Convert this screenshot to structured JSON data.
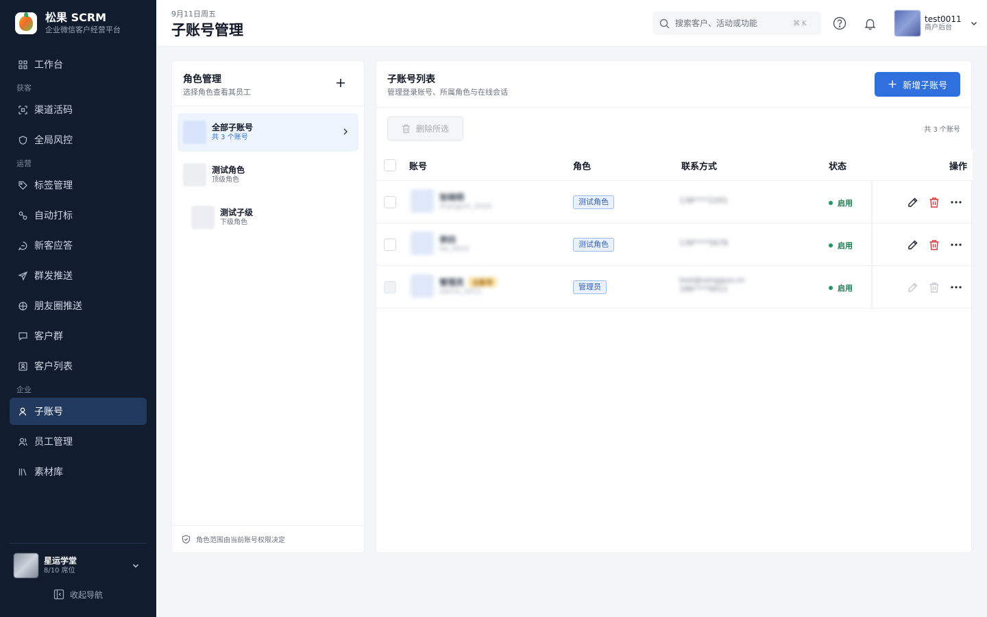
{
  "brand": {
    "title": "松果 SCRM",
    "subtitle": "企业微信客户经营平台"
  },
  "nav": {
    "workspace": "工作台",
    "group_acquire": "获客",
    "channel_code": "渠道活码",
    "risk_control": "全局风控",
    "group_ops": "运营",
    "tag_mgmt": "标签管理",
    "auto_tag": "自动打标",
    "new_customer": "新客应答",
    "mass_send": "群发推送",
    "moments": "朋友圈推送",
    "customer_group": "客户群",
    "customer_list": "客户列表",
    "group_enterprise": "企业",
    "sub_accounts": "子账号",
    "staff": "员工管理",
    "materials": "素材库"
  },
  "org": {
    "name": "星运学堂",
    "seats": "8/10 席位"
  },
  "collapse_label": "收起导航",
  "header": {
    "date": "9月11日周五",
    "title": "子账号管理",
    "search_placeholder": "搜索客户、活动或功能",
    "shortcut": "⌘ K",
    "user_name": "test0011",
    "user_role": "商户后台"
  },
  "roles": {
    "title": "角色管理",
    "subtitle": "选择角色查看其员工",
    "items": [
      {
        "name": "全部子账号",
        "meta": "共 3 个账号"
      },
      {
        "name": "测试角色",
        "meta": "顶级角色"
      },
      {
        "name": "测试子级",
        "meta": "下级角色"
      }
    ],
    "footer": "角色范围由当前账号权限决定"
  },
  "accounts": {
    "title": "子账号列表",
    "subtitle": "管理登录账号、所属角色与在线会话",
    "new_label": "新增子账号",
    "delete_selected": "删除所选",
    "count": "共 3 个账号",
    "columns": {
      "account": "账号",
      "role": "角色",
      "contact": "联系方式",
      "status": "状态",
      "ops": "操作"
    },
    "rows": [
      {
        "name": "张晓明",
        "id": "zhangxm_2020",
        "role": "测试角色",
        "contact": "138****2201",
        "status": "启用"
      },
      {
        "name": "李四",
        "id": "lisi_0932",
        "role": "测试角色",
        "contact": "139****5678",
        "status": "启用"
      },
      {
        "name": "管理员",
        "vip": "主账号",
        "id": "admin_0011",
        "role": "管理员",
        "contact": "test@songguo.cn",
        "contact2": "186****0011",
        "status": "启用"
      }
    ]
  },
  "colors": {
    "sidebar": "#111c2f",
    "active_nav": "#22395e",
    "primary": "#2f6fde",
    "danger": "#d43b3b",
    "success": "#1d9a5c"
  }
}
